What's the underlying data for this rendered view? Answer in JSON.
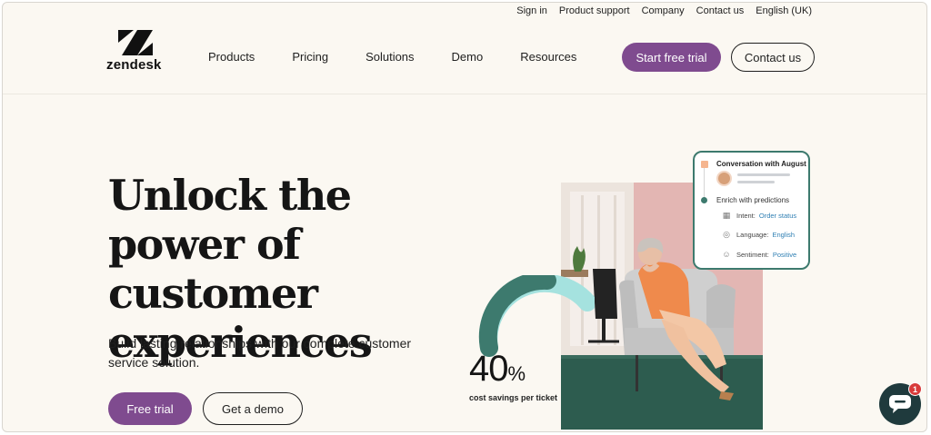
{
  "utility_nav": {
    "sign_in": "Sign in",
    "product_support": "Product support",
    "company": "Company",
    "contact_us": "Contact us",
    "language": "English (UK)"
  },
  "brand": {
    "name": "zendesk",
    "accent_purple": "#7f4b8f",
    "accent_teal": "#3d7a6e"
  },
  "main_nav": {
    "products": "Products",
    "pricing": "Pricing",
    "solutions": "Solutions",
    "demo": "Demo",
    "resources": "Resources",
    "start_trial": "Start free trial",
    "contact": "Contact us"
  },
  "hero": {
    "title": "Unlock the power of customer experiences",
    "subtitle": "Build lasting relationships with our complete customer service solution.",
    "primary_cta": "Free trial",
    "secondary_cta": "Get a demo"
  },
  "stat": {
    "value": "40",
    "unit": "%",
    "label": "cost savings per ticket",
    "gauge_fraction": 0.4
  },
  "insight_card": {
    "title": "Conversation with August",
    "enrich": "Enrich with predictions",
    "rows": [
      {
        "icon": "grid-icon",
        "label": "Intent:",
        "value": "Order status"
      },
      {
        "icon": "globe-icon",
        "label": "Language:",
        "value": "English"
      },
      {
        "icon": "smile-icon",
        "label": "Sentiment:",
        "value": "Positive"
      }
    ]
  },
  "chat_widget": {
    "badge_count": "1"
  }
}
